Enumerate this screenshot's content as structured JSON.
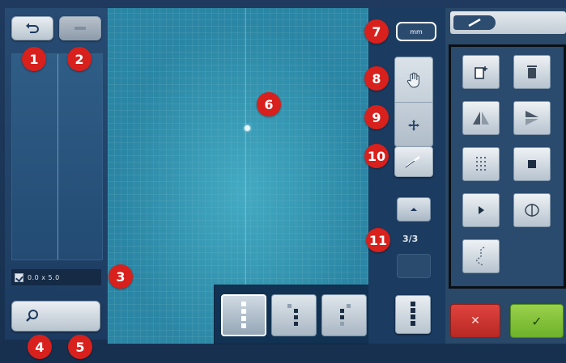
{
  "selection_size": "0.0 x 5.0",
  "unit_button": "mm",
  "page_indicator": "3/3",
  "callouts": [
    "1",
    "2",
    "3",
    "4",
    "5",
    "6",
    "7",
    "8",
    "9",
    "10",
    "11"
  ],
  "colors": {
    "marker": "#d8201c",
    "canvas": "#2a86a4",
    "cancel": "#d23a35",
    "confirm": "#8cc63f"
  },
  "icons": {
    "undo": "undo-icon",
    "redo": "redo-icon",
    "zoom": "magnifier-icon",
    "pan": "hand-icon",
    "move": "move-arrows-icon",
    "edit": "pencil-icon",
    "cancel": "cross-icon",
    "confirm": "check-icon"
  }
}
